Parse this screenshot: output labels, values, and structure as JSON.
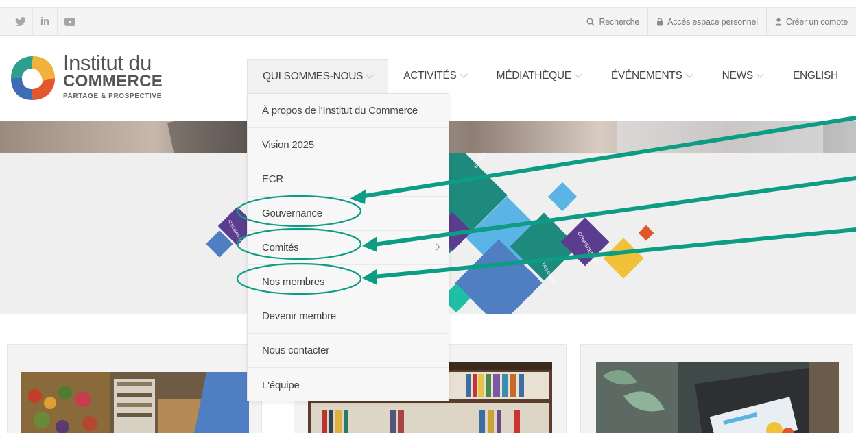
{
  "topbar": {
    "social": [
      {
        "icon": "twitter-icon"
      },
      {
        "icon": "linkedin-icon",
        "label": "in"
      },
      {
        "icon": "youtube-icon"
      }
    ],
    "links": [
      {
        "icon": "search-icon",
        "label": "Recherche"
      },
      {
        "icon": "lock-icon",
        "label": "Accès espace personnel"
      },
      {
        "icon": "user-icon",
        "label": "Créer un compte"
      }
    ]
  },
  "logo": {
    "line1": "Institut du",
    "line2": "COMMERCE",
    "line3": "PARTAGE & PROSPECTIVE"
  },
  "nav": {
    "items": [
      {
        "label": "QUI SOMMES-NOUS"
      },
      {
        "label": "ACTIVITÉS"
      },
      {
        "label": "MÉDIATHÈQUE"
      },
      {
        "label": "ÉVÉNEMENTS"
      },
      {
        "label": "NEWS"
      },
      {
        "label": "ENGLISH"
      }
    ]
  },
  "dropdown": {
    "items": [
      {
        "label": "À propos de l'Institut du Commerce"
      },
      {
        "label": "Vision 2025"
      },
      {
        "label": "ECR"
      },
      {
        "label": "Gouvernance"
      },
      {
        "label": "Comités"
      },
      {
        "label": "Nos membres"
      },
      {
        "label": "Devenir membre"
      },
      {
        "label": "Nous contacter"
      },
      {
        "label": "L'équipe"
      }
    ]
  },
  "hero": {
    "tile_labels": [
      "EFFICIENT CONSUMER RESPONSE",
      "CONFÉRENCES",
      "ATELIERS PROSPECTIVE",
      "DES COURS"
    ]
  },
  "colors": {
    "annotation": "#0d9c84",
    "teal": "#1e8a7e",
    "purple": "#5b3c8f",
    "blue": "#4f7fc2",
    "light_blue": "#5ab4e6",
    "yellow": "#f2c13a",
    "orange": "#e0572b"
  }
}
